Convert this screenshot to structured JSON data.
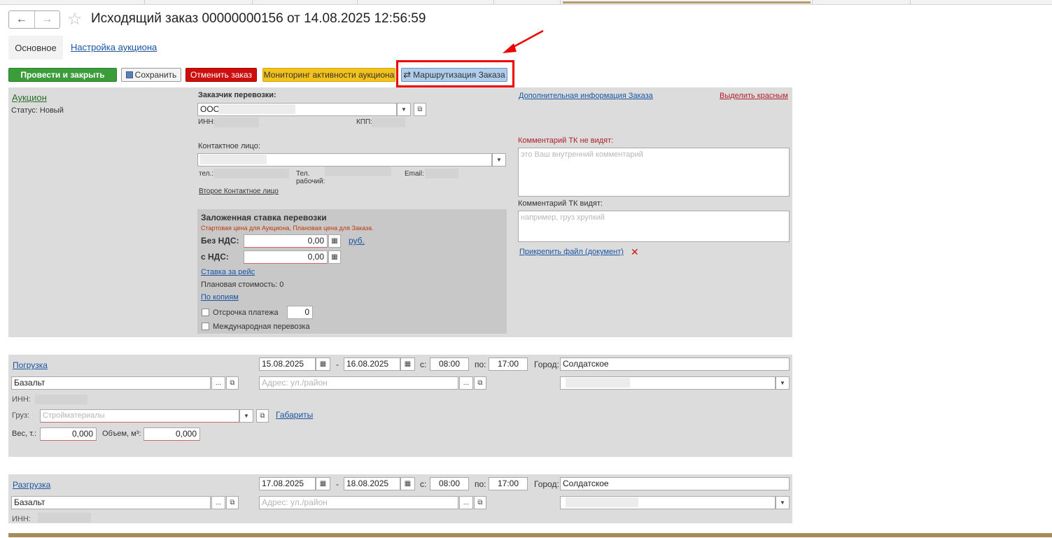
{
  "window": {
    "title": "Исходящий заказ 00000000156 от 14.08.2025 12:56:59"
  },
  "tabs": {
    "main": "Основное",
    "auction_settings": "Настройка аукциона"
  },
  "toolbar": {
    "post_close": "Провести и закрыть",
    "save": "Сохранить",
    "cancel_order": "Отменить заказ",
    "monitoring": "Мониторинг активности аукциона",
    "routing": "Маршрутизация Заказа"
  },
  "header_panel": {
    "auction_link": "Аукцион",
    "status": "Статус: Новый",
    "customer_label": "Заказчик перевозки:",
    "customer_value": "ООО",
    "inn_label": "ИНН:",
    "kpp_label": "КПП:",
    "contact_label": "Контактное лицо:",
    "tel_label": "тел.:",
    "tel_work_label_1": "Тел.",
    "tel_work_label_2": "рабочий:",
    "email_label": "Email:",
    "second_contact": "Второе Контактное лицо",
    "additional_info": "Дополнительная информация Заказа",
    "mark_red": "Выделить красным",
    "comment_hidden_label": "Комментарий ТК не видят:",
    "comment_hidden_placeholder": "это Ваш внутренний комментарий",
    "comment_visible_label": "Комментарий ТК видят:",
    "comment_visible_placeholder": "например, груз хрупкий",
    "attach_file": "Прикрепить файл (документ)"
  },
  "rate_panel": {
    "title": "Заложенная ставка перевозки",
    "hint": "Стартовая цена для Аукциона, Плановая цена для Заказа.",
    "no_vat_label": "Без НДС:",
    "no_vat_value": "0,00",
    "currency": "руб.",
    "vat_label": "с НДС:",
    "vat_value": "0,00",
    "rate_per_trip": "Ставка за рейс",
    "planned_cost": "Плановая стоимость: 0",
    "by_copies": "По копиям",
    "deferral_label": "Отсрочка платежа",
    "deferral_value": "0",
    "international_label": "Международная перевозка"
  },
  "loading": {
    "title": "Погрузка",
    "date_from": "15.08.2025",
    "date_to": "16.08.2025",
    "dash": "-",
    "time_from_label": "с:",
    "time_from": "08:00",
    "time_to_label": "по:",
    "time_to": "17:00",
    "city_label": "Город:",
    "city": "Солдатское",
    "warehouse": "Базальт",
    "address_placeholder": "Адрес: ул./район",
    "inn_label": "ИНН:",
    "cargo_label": "Груз:",
    "cargo_placeholder": "Стройматериалы",
    "dimensions": "Габариты",
    "weight_label": "Вес, т.:",
    "weight": "0,000",
    "volume_label": "Объем, м³:",
    "volume": "0,000"
  },
  "unloading": {
    "title": "Разгрузка",
    "date_from": "17.08.2025",
    "date_to": "18.08.2025",
    "dash": "-",
    "time_from_label": "с:",
    "time_from": "08:00",
    "time_to_label": "по:",
    "time_to": "17:00",
    "city_label": "Город:",
    "city": "Солдатское",
    "warehouse": "Базальт",
    "address_placeholder": "Адрес: ул./район",
    "inn_label": "ИНН:"
  },
  "colors": {
    "green": "#3a9d3a",
    "red": "#cc0e0e",
    "yellow": "#f3c21c",
    "blue": "#aecdeb",
    "link": "#1a55a3",
    "highlight": "#e00000"
  }
}
